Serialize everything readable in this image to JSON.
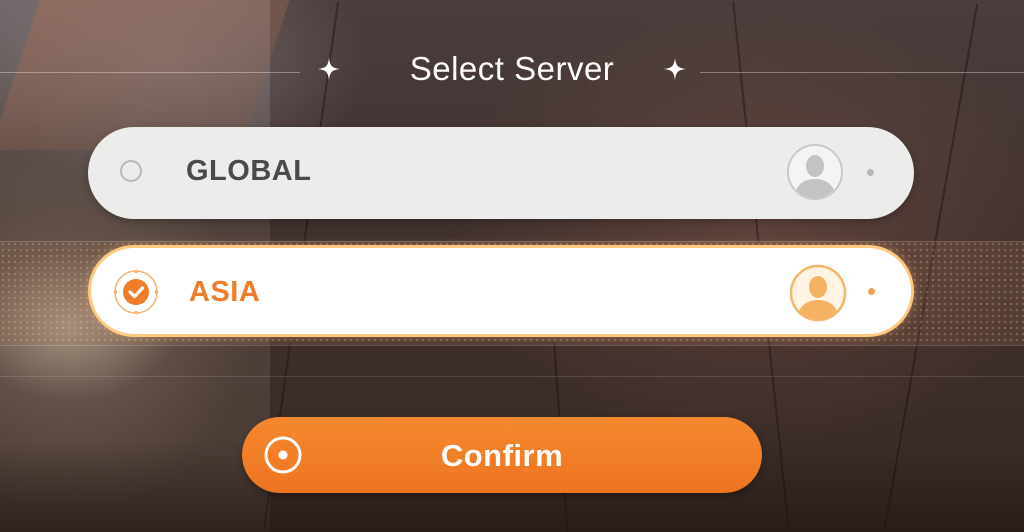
{
  "dialog": {
    "title": "Select Server"
  },
  "servers": [
    {
      "label": "GLOBAL",
      "selected": false,
      "radio_icon": "radio-empty-icon",
      "avatar_icon": "user-avatar-icon"
    },
    {
      "label": "ASIA",
      "selected": true,
      "radio_icon": "radio-checked-icon",
      "avatar_icon": "user-avatar-icon"
    }
  ],
  "confirm": {
    "label": "Confirm",
    "icon": "target-ring-icon"
  },
  "colors": {
    "accent": "#f07c2a",
    "selected_border": "#ffc982",
    "unselected_bg": "#ececea",
    "selected_bg": "#ffffff",
    "confirm_bg": "#ee7421"
  }
}
